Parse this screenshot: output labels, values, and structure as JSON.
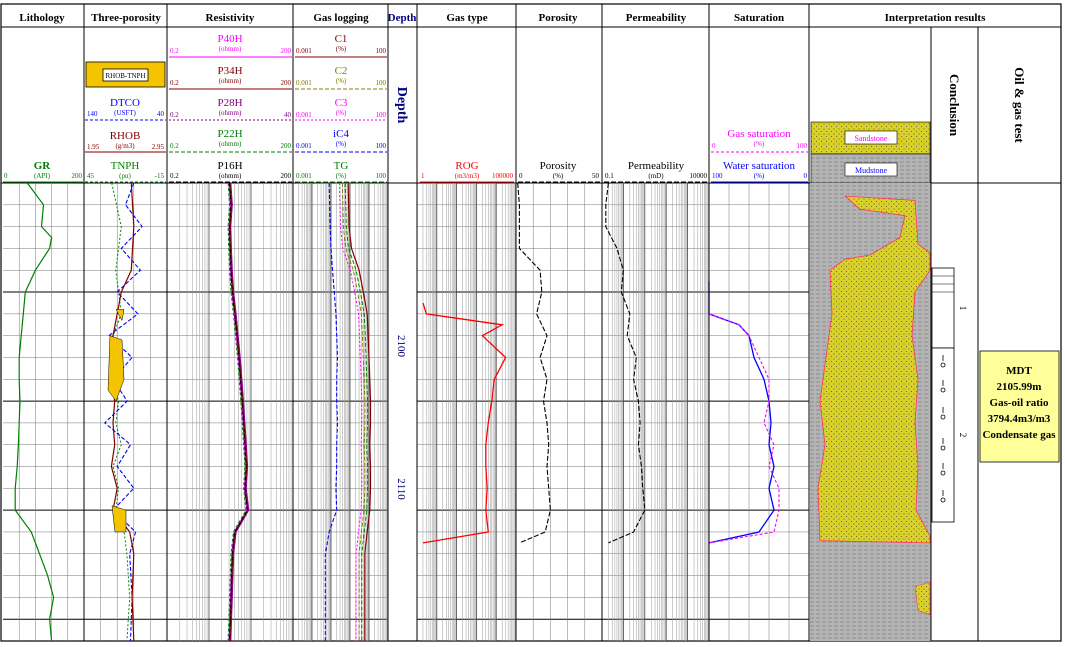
{
  "columns": {
    "lithology": "Lithology",
    "three_porosity": "Three-porosity",
    "resistivity": "Resistivity",
    "gas_logging": "Gas logging",
    "depth": "Depth",
    "gas_type": "Gas type",
    "porosity": "Porosity",
    "permeability": "Permeability",
    "saturation": "Saturation",
    "interpretation": "Interpretation results"
  },
  "depth_label": "Depth",
  "depth_ticks": [
    "2100",
    "2110"
  ],
  "curves": {
    "gr": {
      "name": "GR",
      "unit": "(API)",
      "min": "0",
      "max": "200",
      "color": "#008000"
    },
    "rhob_tnph": {
      "name": "RHOB-TNPH",
      "color": "#f5c400"
    },
    "dtco": {
      "name": "DTCO",
      "unit": "(USFT)",
      "min": "140",
      "max": "40",
      "color": "#0000ff"
    },
    "rhob": {
      "name": "RHOB",
      "unit": "(g/m3)",
      "min": "1.95",
      "max": "2.95",
      "color": "#800000"
    },
    "tnph": {
      "name": "TNPH",
      "unit": "(pu)",
      "min": "45",
      "max": "-15",
      "color": "#008000"
    },
    "p40h": {
      "name": "P40H",
      "unit": "(ohmm)",
      "min": "0.2",
      "max": "200",
      "color": "#ff00ff"
    },
    "p34h": {
      "name": "P34H",
      "unit": "(ohmm)",
      "min": "0.2",
      "max": "200",
      "color": "#800000"
    },
    "p28h": {
      "name": "P28H",
      "unit": "(ohmm)",
      "min": "0.2",
      "max": "40",
      "color": "#800080"
    },
    "p22h": {
      "name": "P22H",
      "unit": "(ohmm)",
      "min": "0.2",
      "max": "200",
      "color": "#008000"
    },
    "p16h": {
      "name": "P16H",
      "unit": "(ohmm)",
      "min": "0.2",
      "max": "200",
      "color": "#000000"
    },
    "c1": {
      "name": "C1",
      "unit": "(%)",
      "min": "0.001",
      "max": "100",
      "color": "#800000"
    },
    "c2": {
      "name": "C2",
      "unit": "(%)",
      "min": "0.001",
      "max": "100",
      "color": "#808000"
    },
    "c3": {
      "name": "C3",
      "unit": "(%)",
      "min": "0.001",
      "max": "100",
      "color": "#ff00ff"
    },
    "ic4": {
      "name": "iC4",
      "unit": "(%)",
      "min": "0.001",
      "max": "100",
      "color": "#0000ff"
    },
    "tg": {
      "name": "TG",
      "unit": "(%)",
      "min": "0.001",
      "max": "100",
      "color": "#008000"
    },
    "rog": {
      "name": "ROG",
      "unit": "(m3/m3)",
      "min": "1",
      "max": "100000",
      "color": "#ff0000"
    },
    "porosity": {
      "name": "Porosity",
      "unit": "(%)",
      "min": "0",
      "max": "50",
      "color": "#000000"
    },
    "permeability": {
      "name": "Permeability",
      "unit": "(mD)",
      "min": "0.1",
      "max": "10000",
      "color": "#000000"
    },
    "gas_sat": {
      "name": "Gas saturation",
      "unit": "(%)",
      "min": "0",
      "max": "100",
      "color": "#ff00ff"
    },
    "water_sat": {
      "name": "Water saturation",
      "unit": "(%)",
      "min": "100",
      "max": "0",
      "color": "#0000ff"
    }
  },
  "legend": {
    "sandstone": "Sandstone",
    "mudstone": "Mudstone"
  },
  "conclusion": "Conclusion",
  "oil_gas_test": "Oil & gas test",
  "layers": [
    "1",
    "2"
  ],
  "mdt_box": [
    "MDT",
    "2105.99m",
    "Gas-oil ratio",
    "3794.4m3/m3",
    "Condensate gas"
  ],
  "colors": {
    "sand": "#d9d12a",
    "mud": "#b4b4b4",
    "test_box": "#ffff99",
    "grid": "#000000"
  },
  "chart_data": {
    "type": "line",
    "x_label": "Depth",
    "x_unit": "m",
    "depth_range": [
      2095,
      2116
    ],
    "series": [
      {
        "name": "GR",
        "x": [
          2095.0,
          2096.0,
          2097.0,
          2097.5,
          2098.0,
          2099.0,
          2100.0,
          2101.0,
          2102.0,
          2103.0,
          2104.0,
          2105.0,
          2106.0,
          2107.0,
          2108.0,
          2109.0,
          2110.0,
          2111.0,
          2112.0,
          2113.0,
          2114.0,
          2115.0,
          2116.0
        ],
        "y": [
          60,
          100,
          95,
          120,
          115,
          80,
          55,
          50,
          45,
          40,
          40,
          42,
          40,
          38,
          35,
          30,
          30,
          70,
          90,
          110,
          125,
          115,
          120
        ]
      },
      {
        "name": "ROG",
        "x": [
          2100.5,
          2101.0,
          2101.5,
          2102.0,
          2103.0,
          2104.0,
          2105.0,
          2106.0,
          2107.0,
          2108.0,
          2109.0,
          2110.0,
          2111.0,
          2111.5
        ],
        "y": [
          2,
          3,
          20000,
          2000,
          30000,
          8000,
          6000,
          4000,
          3000,
          3000,
          3500,
          3000,
          4000,
          2
        ]
      },
      {
        "name": "Porosity",
        "x": [
          2095.0,
          2096.0,
          2098.0,
          2099.0,
          2100.0,
          2101.0,
          2102.0,
          2103.0,
          2104.0,
          2105.0,
          2106.0,
          2107.0,
          2108.0,
          2109.0,
          2110.0,
          2111.0,
          2111.5
        ],
        "y": [
          1,
          2,
          2,
          14,
          15,
          12,
          18,
          14,
          18,
          16,
          18,
          19,
          18,
          19,
          20,
          17,
          2
        ]
      },
      {
        "name": "Water saturation",
        "x": [
          2099.5,
          2100.0,
          2101.0,
          2101.5,
          2102.0,
          2103.0,
          2104.0,
          2105.0,
          2106.0,
          2107.0,
          2108.0,
          2109.0,
          2110.0,
          2111.0,
          2111.5
        ],
        "y": [
          100,
          100,
          100,
          70,
          60,
          55,
          45,
          40,
          38,
          40,
          35,
          40,
          35,
          50,
          100
        ]
      },
      {
        "name": "Gas saturation",
        "x": [
          2101.0,
          2101.5,
          2102.0,
          2103.0,
          2104.0,
          2105.0,
          2106.0,
          2107.0,
          2108.0,
          2109.0,
          2110.0,
          2111.0,
          2111.5
        ],
        "y": [
          0,
          30,
          40,
          50,
          60,
          60,
          55,
          65,
          60,
          70,
          70,
          65,
          0
        ]
      }
    ]
  }
}
